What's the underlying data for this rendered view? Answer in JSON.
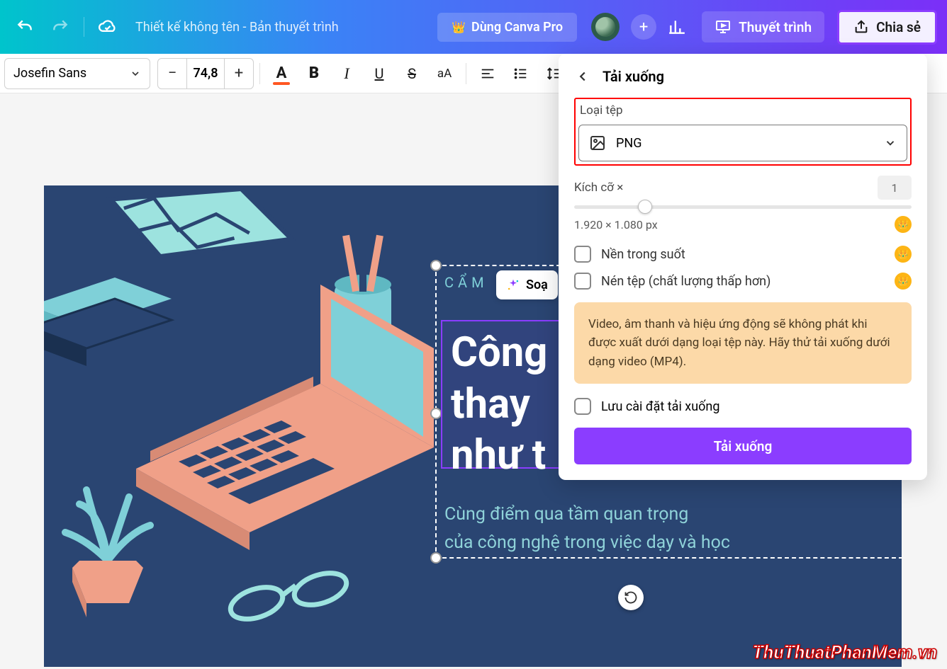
{
  "header": {
    "doc_title": "Thiết kế không tên - Bản thuyết trình",
    "pro_label": "Dùng Canva Pro",
    "present_label": "Thuyết trình",
    "share_label": "Chia sẻ"
  },
  "toolbar": {
    "font_name": "Josefin Sans",
    "font_size": "74,8"
  },
  "slide": {
    "eyebrow": "CẨM N",
    "title_line1": "Công",
    "title_line2": "thay",
    "title_line3": "như t",
    "subtitle_line1": "Cùng điểm qua tầm quan trọng",
    "subtitle_line2": "của công nghệ trong việc dạy và học",
    "magic_label": "Soạ"
  },
  "download": {
    "panel_title": "Tải xuống",
    "filetype_label": "Loại tệp",
    "filetype_value": "PNG",
    "size_label": "Kích cỡ ×",
    "size_multiplier": "1",
    "dimensions": "1.920 × 1.080 px",
    "transparent_label": "Nền trong suốt",
    "compress_label": "Nén tệp (chất lượng thấp hơn)",
    "info_text": "Video, âm thanh và hiệu ứng động sẽ không phát khi được xuất dưới dạng loại tệp này. Hãy thử tải xuống dưới dạng video (MP4).",
    "save_settings_label": "Lưu cài đặt tải xuống",
    "download_button": "Tải xuống"
  },
  "watermark": "ThuThuatPhanMem.vn"
}
